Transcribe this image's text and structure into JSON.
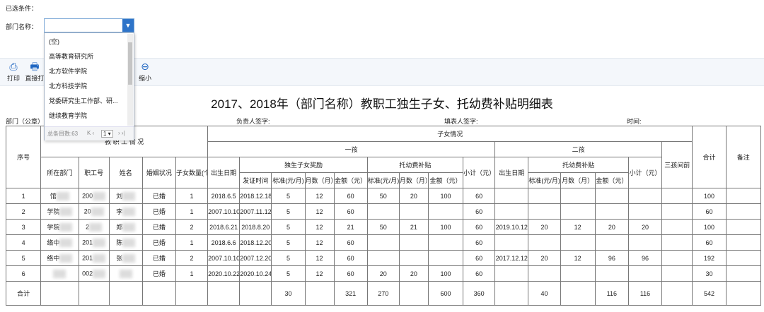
{
  "filter": {
    "title": "已选条件：",
    "dept_label": "部门名称：",
    "options": [
      "(空)",
      "高等教育研究所",
      "北方软件学院",
      "北方科技学院",
      "党委研究生工作部、研...",
      "继续教育学院"
    ],
    "footer_total": "总条目数:63",
    "footer_prev": "K ‹",
    "footer_page": "1 ▾",
    "footer_next": "› ›|"
  },
  "toolbar": {
    "print": "打印",
    "direct_print": "直接打",
    "shrink": "缩小"
  },
  "report": {
    "title": "2017、2018年（部门名称）教职工独生子女、托幼费补贴明细表",
    "dept": "部门（公章）",
    "leader": "负责人签字:",
    "filler": "填表人签字:",
    "time": "时间:"
  },
  "headers": {
    "seq": "序号",
    "staff": "教 职 工 情 况",
    "dept": "所在部门",
    "staff_no": "职工号",
    "name": "姓名",
    "marital": "婚姻状况",
    "child_count": "子女数量(个)",
    "children": "子女情况",
    "first": "一孩",
    "second": "二孩",
    "birth": "出生日期",
    "only_child_award": "独生子女奖励",
    "childcare": "托幼费补贴",
    "issue_time": "发证时间",
    "std": "标准(元/月)",
    "months": "月数（月）",
    "amount": "金额（元）",
    "subtotal": "小计（元）",
    "third": "三孩间前",
    "total": "合计",
    "remark": "备注"
  },
  "rows": [
    {
      "seq": "1",
      "dept": "馆",
      "no": "200",
      "name": "刘",
      "marital": "已婚",
      "kids": "1",
      "b1": "2018.6.5",
      "issue": "2018.12.18",
      "os": "5",
      "om": "12",
      "oa": "60",
      "cs": "50",
      "cm": "20",
      "ca": "100",
      "sub1": "60",
      "b2": "",
      "s2": "",
      "m2": "",
      "a2": "",
      "sub2": "",
      "total": "100"
    },
    {
      "seq": "2",
      "dept": "学院",
      "no": "20",
      "name": "李",
      "marital": "已婚",
      "kids": "1",
      "b1": "2007.10.10",
      "issue": "2007.11.12",
      "os": "5",
      "om": "12",
      "oa": "60",
      "cs": "",
      "cm": "",
      "ca": "",
      "sub1": "60",
      "b2": "",
      "s2": "",
      "m2": "",
      "a2": "",
      "sub2": "",
      "total": "60"
    },
    {
      "seq": "3",
      "dept": "学院",
      "no": "2",
      "name": "郑",
      "marital": "已婚",
      "kids": "2",
      "b1": "2018.6.21",
      "issue": "2018.8.20",
      "os": "5",
      "om": "12",
      "oa": "21",
      "cs": "50",
      "cm": "21",
      "ca": "100",
      "sub1": "60",
      "b2": "2019.10.12",
      "s2": "20",
      "m2": "12",
      "a2": "20",
      "sub2": "20",
      "total": "100"
    },
    {
      "seq": "4",
      "dept": "络中",
      "no": "201",
      "name": "陈",
      "marital": "已婚",
      "kids": "1",
      "b1": "2018.6.6",
      "issue": "2018.12.20",
      "os": "5",
      "om": "12",
      "oa": "60",
      "cs": "",
      "cm": "",
      "ca": "",
      "sub1": "60",
      "b2": "",
      "s2": "",
      "m2": "",
      "a2": "",
      "sub2": "",
      "total": "60"
    },
    {
      "seq": "5",
      "dept": "络中",
      "no": "201",
      "name": "张",
      "marital": "已婚",
      "kids": "2",
      "b1": "2007.10.10",
      "issue": "2007.12.20",
      "os": "5",
      "om": "12",
      "oa": "60",
      "cs": "",
      "cm": "",
      "ca": "",
      "sub1": "60",
      "b2": "2017.12.12",
      "s2": "20",
      "m2": "12",
      "a2": "96",
      "sub2": "96",
      "total": "192"
    },
    {
      "seq": "6",
      "dept": "",
      "no": "002",
      "name": "",
      "marital": "已婚",
      "kids": "1",
      "b1": "2020.10.22",
      "issue": "2020.10.24",
      "os": "5",
      "om": "12",
      "oa": "60",
      "cs": "20",
      "cm": "20",
      "ca": "100",
      "sub1": "60",
      "b2": "",
      "s2": "",
      "m2": "",
      "a2": "",
      "sub2": "",
      "total": "30"
    }
  ],
  "totals": {
    "label": "合计",
    "os": "30",
    "oa": "321",
    "cs": "270",
    "ca": "600",
    "sub1": "360",
    "s2": "40",
    "a2": "116",
    "sub2": "116",
    "total": "542"
  }
}
